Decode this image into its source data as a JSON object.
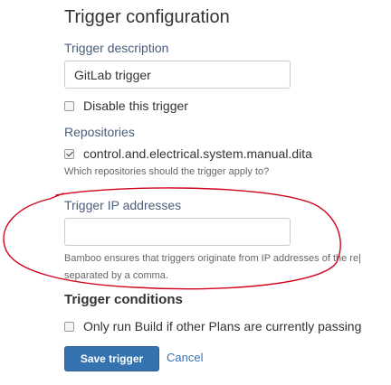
{
  "page": {
    "title": "Trigger configuration"
  },
  "trigger_description": {
    "label": "Trigger description",
    "value": "GitLab trigger"
  },
  "disable_trigger": {
    "label": "Disable this trigger",
    "checked": false
  },
  "repositories": {
    "label": "Repositories",
    "items": [
      {
        "label": "control.and.electrical.system.manual.dita",
        "checked": true
      }
    ],
    "help": "Which repositories should the trigger apply to?"
  },
  "trigger_ip": {
    "label": "Trigger IP addresses",
    "value": "",
    "help_line1": "Bamboo ensures that triggers originate from IP addresses of the re|",
    "help_line2": "separated by a comma."
  },
  "trigger_conditions": {
    "title": "Trigger conditions",
    "only_run_label": "Only run Build if other Plans are currently passing",
    "only_run_checked": false
  },
  "actions": {
    "save_label": "Save trigger",
    "cancel_label": "Cancel"
  },
  "colors": {
    "primary": "#3572b0",
    "annotation": "#d0021b"
  }
}
